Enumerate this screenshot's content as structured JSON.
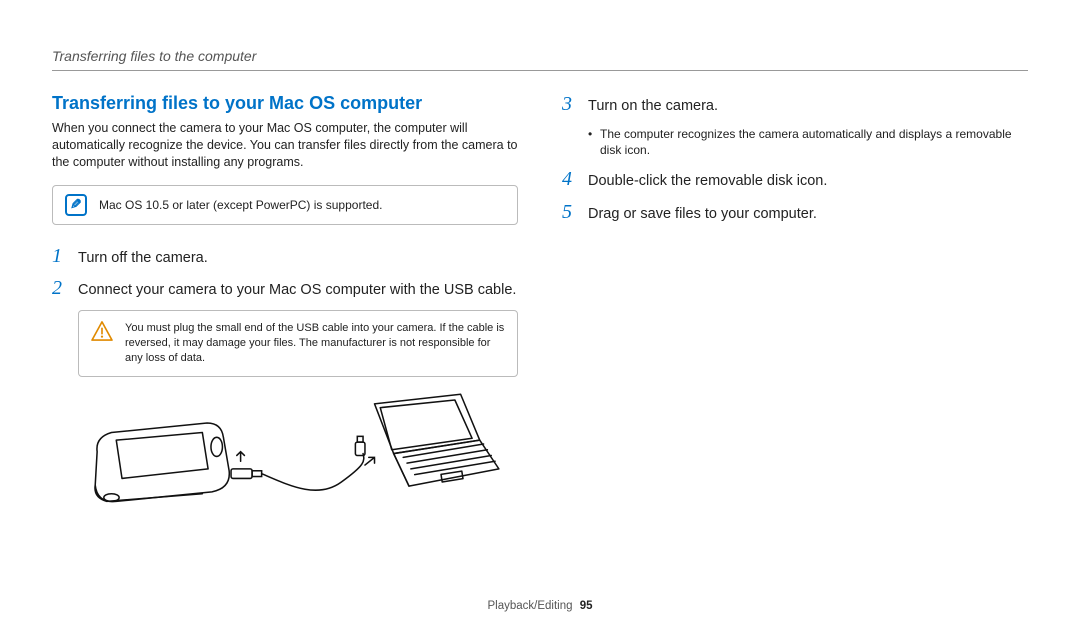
{
  "header": {
    "running": "Transferring files to the computer"
  },
  "section": {
    "title": "Transferring files to your Mac OS computer",
    "intro": "When you connect the camera to your Mac OS computer, the computer will automatically recognize the device. You can transfer files directly from the camera to the computer without installing any programs.",
    "note": "Mac OS 10.5 or later (except PowerPC) is supported."
  },
  "steps": {
    "s1": {
      "num": "1",
      "text": "Turn off the camera."
    },
    "s2": {
      "num": "2",
      "text": "Connect your camera to your Mac OS computer with the USB cable.",
      "warn": "You must plug the small end of the USB cable into your camera. If the cable is reversed, it may damage your files. The manufacturer is not responsible for any loss of data."
    },
    "s3": {
      "num": "3",
      "text": "Turn on the camera.",
      "bullet": "The computer recognizes the camera automatically and displays a removable disk icon."
    },
    "s4": {
      "num": "4",
      "text": "Double-click the removable disk icon."
    },
    "s5": {
      "num": "5",
      "text": "Drag or save files to your computer."
    }
  },
  "footer": {
    "section": "Playback/Editing",
    "page": "95"
  }
}
